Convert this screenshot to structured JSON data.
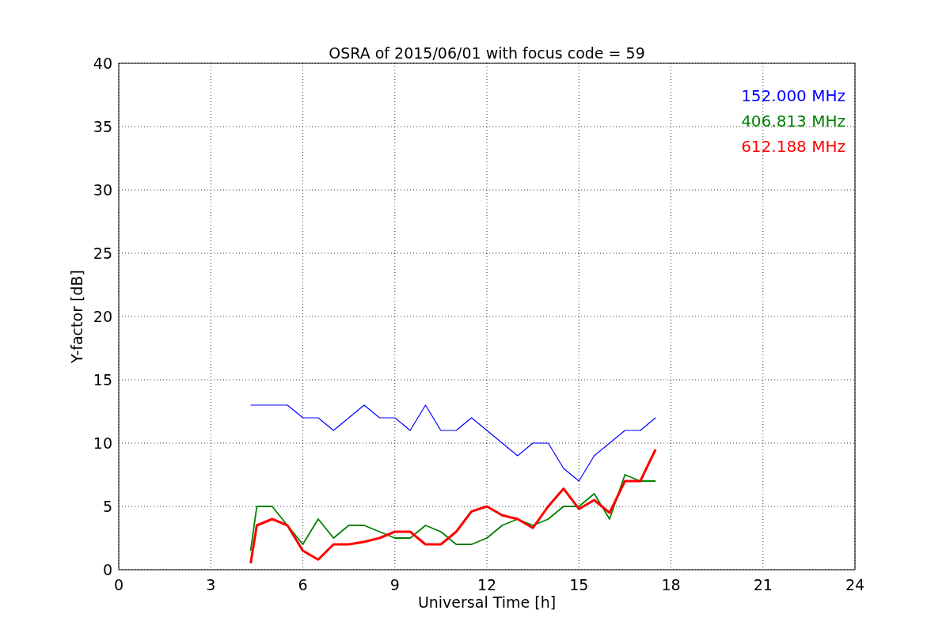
{
  "chart": {
    "chart_data": {
      "type": "line",
      "title": "OSRA of 2015/06/01 with focus code = 59",
      "xlabel": "Universal Time [h]",
      "ylabel": "Y-factor [dB]",
      "x": [
        4.3,
        4.5,
        5,
        5.5,
        6,
        6.5,
        7,
        7.5,
        8,
        8.5,
        9,
        9.5,
        10,
        10.5,
        11,
        11.5,
        12,
        12.5,
        13,
        13.5,
        14,
        14.5,
        15,
        15.5,
        16,
        16.5,
        17,
        17.5
      ],
      "series": [
        {
          "name": "152.000 MHz",
          "color": "#0000ff",
          "values": [
            13,
            13,
            13,
            13,
            12,
            12,
            11,
            12,
            13,
            12,
            12,
            11,
            13,
            11,
            11,
            12,
            11,
            10,
            9,
            10,
            10,
            8,
            7,
            9,
            10,
            11,
            11,
            12
          ]
        },
        {
          "name": "406.813 MHz",
          "color": "#008000",
          "values": [
            1.5,
            5,
            5,
            3.5,
            2,
            4,
            2.5,
            3.5,
            3.5,
            3,
            2.5,
            2.5,
            3.5,
            3,
            2,
            2,
            2.5,
            3.5,
            4,
            3.5,
            4,
            5,
            5,
            6,
            4,
            7.5,
            7,
            7
          ]
        },
        {
          "name": "612.188 MHz",
          "color": "#ff0000",
          "values": [
            0.5,
            3.5,
            4,
            3.5,
            1.5,
            0.8,
            2,
            2,
            2.2,
            2.5,
            3,
            3,
            2,
            2,
            3,
            4.6,
            5,
            4.3,
            4,
            3.3,
            5,
            6.4,
            4.8,
            5.5,
            4.5,
            7,
            7,
            9.5
          ]
        }
      ],
      "grid": true,
      "xlim": [
        0,
        24
      ],
      "ylim": [
        0,
        40
      ],
      "xticks": [
        0,
        3,
        6,
        9,
        12,
        15,
        18,
        21,
        24
      ],
      "yticks": [
        0,
        5,
        10,
        15,
        20,
        25,
        30,
        35,
        40
      ]
    }
  }
}
